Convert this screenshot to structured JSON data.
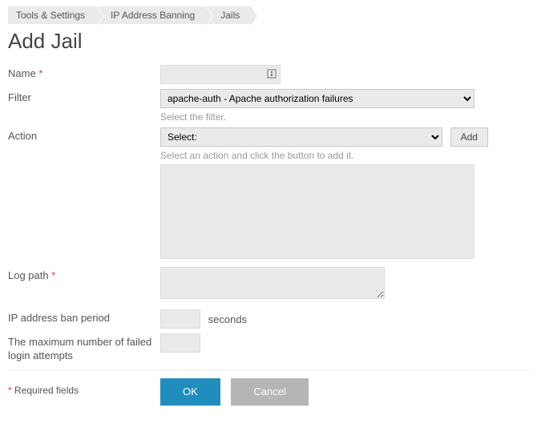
{
  "breadcrumb": [
    {
      "label": "Tools & Settings"
    },
    {
      "label": "IP Address Banning"
    },
    {
      "label": "Jails"
    }
  ],
  "title": "Add Jail",
  "fields": {
    "name": {
      "label": "Name",
      "value": ""
    },
    "filter": {
      "label": "Filter",
      "selected": "apache-auth - Apache authorization failures",
      "hint": "Select the filter."
    },
    "action": {
      "label": "Action",
      "selected": "Select:",
      "add_label": "Add",
      "hint": "Select an action and click the button to add it."
    },
    "logpath": {
      "label": "Log path",
      "value": ""
    },
    "ban_period": {
      "label": "IP address ban period",
      "value": "",
      "unit": "seconds"
    },
    "max_attempts": {
      "label": "The maximum number of failed login attempts",
      "value": ""
    }
  },
  "footer": {
    "required_note": "Required fields",
    "ok": "OK",
    "cancel": "Cancel"
  }
}
